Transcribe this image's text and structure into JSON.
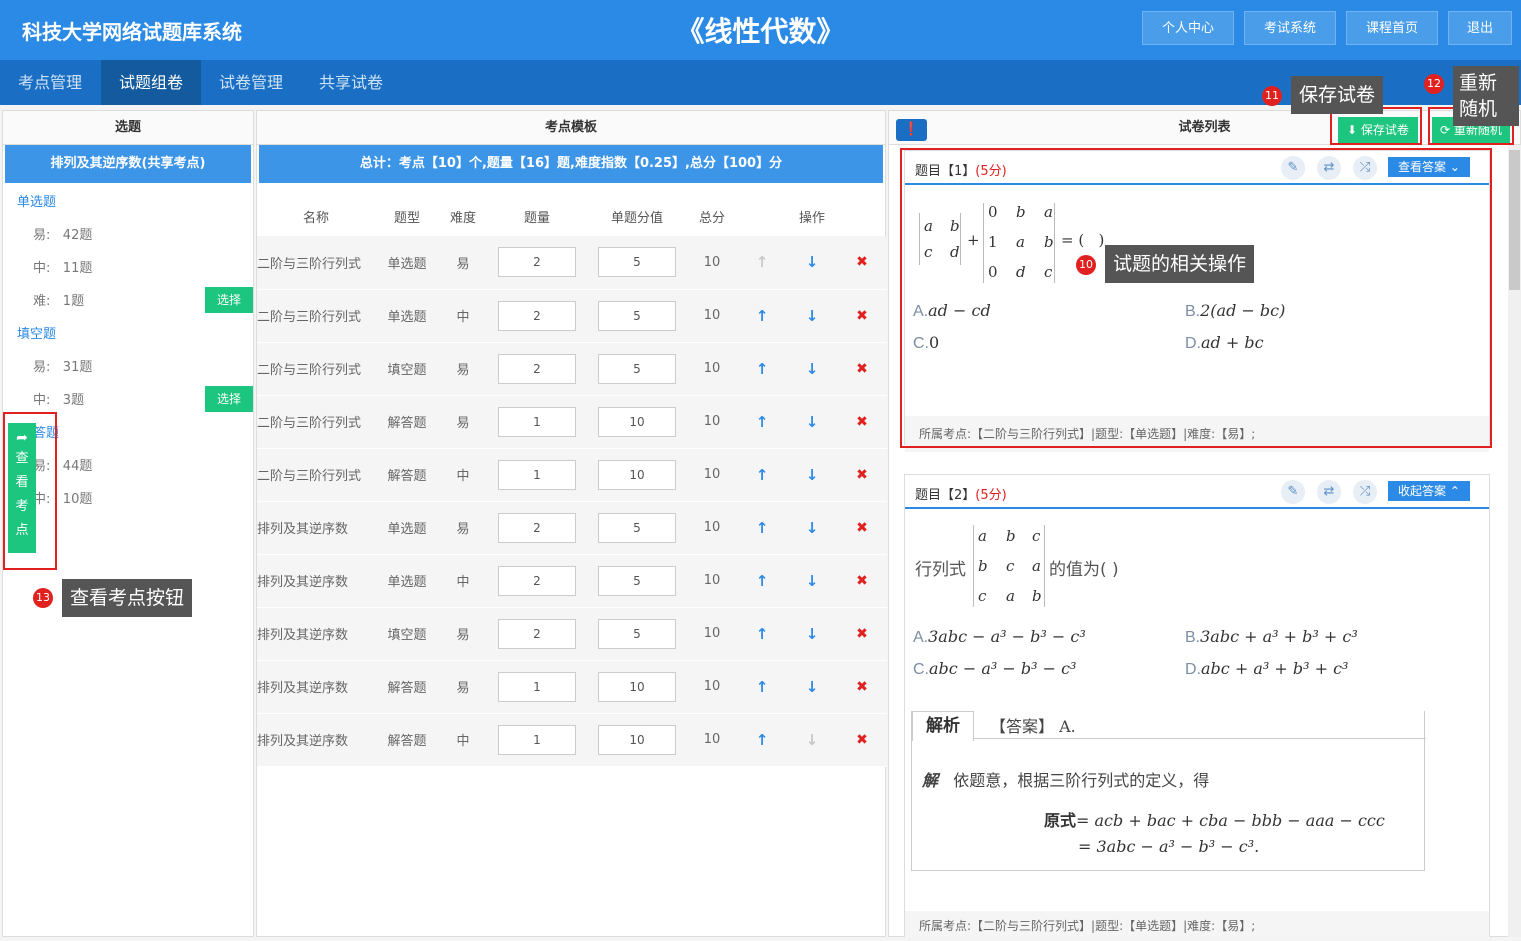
{
  "header": {
    "brand": "科技大学网络试题库系统",
    "course": "《线性代数》",
    "buttons": [
      "个人中心",
      "考试系统",
      "课程首页",
      "退出"
    ]
  },
  "nav": {
    "tabs": [
      "考点管理",
      "试题组卷",
      "试卷管理",
      "共享试卷"
    ],
    "active": 1
  },
  "left": {
    "title": "选题",
    "topic": "排列及其逆序数(共享考点)",
    "categories": [
      {
        "name": "单选题",
        "levels": [
          [
            "易:",
            "42题"
          ],
          [
            "中:",
            "11题"
          ],
          [
            "难:",
            "1题"
          ]
        ]
      },
      {
        "name": "填空题",
        "levels": [
          [
            "易:",
            "31题"
          ],
          [
            "中:",
            "3题"
          ]
        ]
      },
      {
        "name": "答题",
        "levels": [
          [
            "易:",
            "44题"
          ],
          [
            "中:",
            "10题"
          ]
        ]
      }
    ],
    "select_label": "选择",
    "kp_button": "查看考点"
  },
  "middle": {
    "title": "考点模板",
    "summary": "总计：考点【10】个,题量【16】题,难度指数【0.25】,总分【100】分",
    "columns": [
      "名称",
      "题型",
      "难度",
      "题量",
      "单题分值",
      "总分",
      "操作"
    ],
    "rows": [
      [
        "二阶与三阶行列式",
        "单选题",
        "易",
        "2",
        "5",
        "10"
      ],
      [
        "二阶与三阶行列式",
        "单选题",
        "中",
        "2",
        "5",
        "10"
      ],
      [
        "二阶与三阶行列式",
        "填空题",
        "易",
        "2",
        "5",
        "10"
      ],
      [
        "二阶与三阶行列式",
        "解答题",
        "易",
        "1",
        "10",
        "10"
      ],
      [
        "二阶与三阶行列式",
        "解答题",
        "中",
        "1",
        "10",
        "10"
      ],
      [
        "排列及其逆序数",
        "单选题",
        "易",
        "2",
        "5",
        "10"
      ],
      [
        "排列及其逆序数",
        "单选题",
        "中",
        "2",
        "5",
        "10"
      ],
      [
        "排列及其逆序数",
        "填空题",
        "易",
        "2",
        "5",
        "10"
      ],
      [
        "排列及其逆序数",
        "解答题",
        "易",
        "1",
        "10",
        "10"
      ],
      [
        "排列及其逆序数",
        "解答题",
        "中",
        "1",
        "10",
        "10"
      ]
    ]
  },
  "right": {
    "title": "试卷列表",
    "save_btn": "保存试卷",
    "random_btn": "重新随机",
    "q1": {
      "title": "题目【1】",
      "score": "(5分)",
      "answer_btn": "查看答案",
      "options": [
        [
          "A.",
          "ad − cd"
        ],
        [
          "B.",
          "2(ad − bc)"
        ],
        [
          "C.",
          "0"
        ],
        [
          "D.",
          "ad + bc"
        ]
      ],
      "footer": "所属考点:【二阶与三阶行列式】|题型:【单选题】|难度:【易】;"
    },
    "q2": {
      "title": "题目【2】",
      "score": "(5分)",
      "answer_btn": "收起答案",
      "stem_pre": "行列式",
      "stem_post": "的值为(   )",
      "options": [
        [
          "A.",
          "3abc − a³ − b³ − c³"
        ],
        [
          "B.",
          "3abc + a³ + b³ + c³"
        ],
        [
          "C.",
          "abc − a³ − b³ − c³"
        ],
        [
          "D.",
          "abc + a³ + b³ + c³"
        ]
      ],
      "analysis_tab": "解析",
      "answer_text": "【答案】 A.",
      "solution_intro": "依题意，根据三阶行列式的定义，得",
      "solution_label": "解",
      "formula1_label": "原式",
      "formula1": "= acb + bac + cba − bbb − aaa − ccc",
      "formula2": "= 3abc − a³ − b³ − c³.",
      "footer": "所属考点:【二阶与三阶行列式】|题型:【单选题】|难度:【易】;"
    }
  },
  "annotations": {
    "t10": "试题的相关操作",
    "t11": "保存试卷",
    "t12": "重新随机",
    "t13": "查看考点按钮",
    "n10": "10",
    "n11": "11",
    "n12": "12",
    "n13": "13"
  }
}
